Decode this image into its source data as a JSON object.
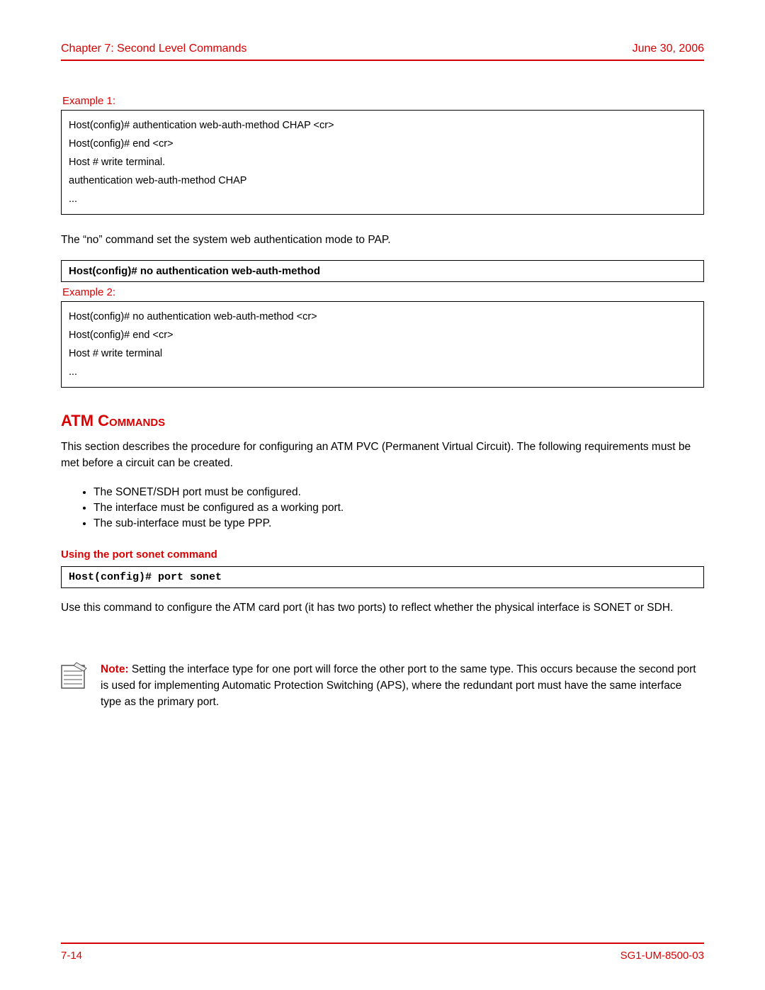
{
  "header": {
    "chapter": "Chapter 7: Second Level Commands",
    "date": "June 30, 2006"
  },
  "example1": {
    "label": "Example 1:",
    "lines": [
      "Host(config)# authentication web-auth-method CHAP <cr>",
      "Host(config)# end <cr>",
      "Host # write terminal.",
      "authentication web-auth-method CHAP",
      "..."
    ]
  },
  "para_no_cmd": "The “no” command set the system web authentication mode to PAP.",
  "cmd_no_auth": "Host(config)# no authentication web-auth-method",
  "example2": {
    "label": "Example 2:",
    "lines": [
      "Host(config)# no authentication web-auth-method <cr>",
      "Host(config)# end <cr>",
      "Host # write terminal",
      "..."
    ]
  },
  "section_heading_main": "ATM",
  "section_heading_sub": "  Commands",
  "section_intro": "This section describes the procedure for configuring an ATM PVC (Permanent Virtual Circuit). The following requirements must be met before a circuit can be created.",
  "requirements": [
    "The SONET/SDH port must be configured.",
    "The interface must be configured as a working port.",
    "The sub-interface must be type PPP."
  ],
  "sub_heading": "Using the port sonet command",
  "cmd_port_sonet": "Host(config)# port sonet",
  "port_sonet_para": "Use this command to configure the ATM card port (it has two ports) to reflect whether the physical interface is SONET or SDH.",
  "note": {
    "label": "Note:",
    "text": " Setting the interface type for one port will force the other port to the same type. This occurs because the second port is used for implementing Automatic Protection Switching (APS), where the redundant port must have the same interface type as the primary port."
  },
  "footer": {
    "page": "7-14",
    "doc": "SG1-UM-8500-03"
  }
}
